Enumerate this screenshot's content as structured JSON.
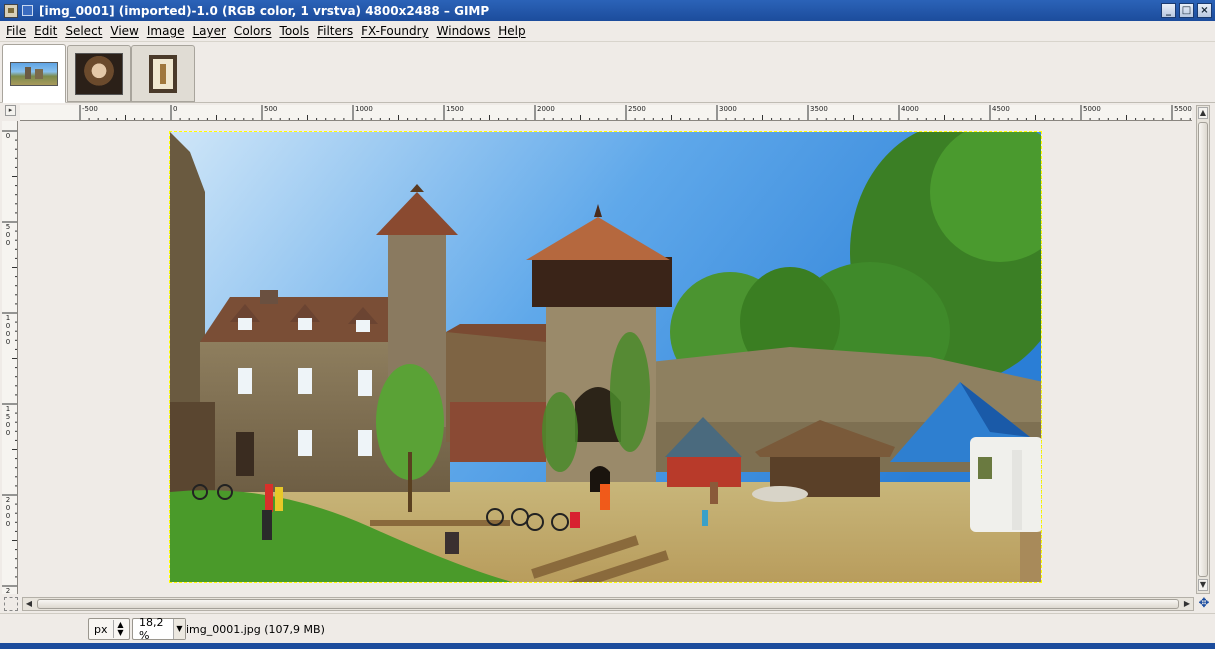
{
  "window": {
    "title": "[img_0001] (imported)-1.0 (RGB color, 1 vrstva) 4800x2488 – GIMP",
    "controls": [
      "_",
      "□",
      "×"
    ]
  },
  "menubar": {
    "items": [
      "File",
      "Edit",
      "Select",
      "View",
      "Image",
      "Layer",
      "Colors",
      "Tools",
      "Filters",
      "FX-Foundry",
      "Windows",
      "Help"
    ]
  },
  "image_tabs": [
    {
      "name": "img_0001 castle panorama",
      "active": true
    },
    {
      "name": "portrait",
      "active": false
    },
    {
      "name": "framed picture",
      "active": false
    }
  ],
  "ruler": {
    "horizontal_labels": [
      "-500",
      "0",
      "500",
      "1000",
      "1500",
      "2000",
      "2500",
      "3000",
      "3500",
      "4000",
      "4500",
      "5000",
      "5500"
    ],
    "vertical_labels": [
      "0",
      "500",
      "1000",
      "1500",
      "2000",
      "2"
    ]
  },
  "status": {
    "unit": "px",
    "zoom": "18,2 %",
    "info": "img_0001.jpg (107,9 MB)"
  },
  "colors": {
    "titlebar": "#1c4c9c",
    "sky": "#3d8ee0",
    "foliage": "#3f8a2a",
    "stone": "#8a7a5c"
  }
}
